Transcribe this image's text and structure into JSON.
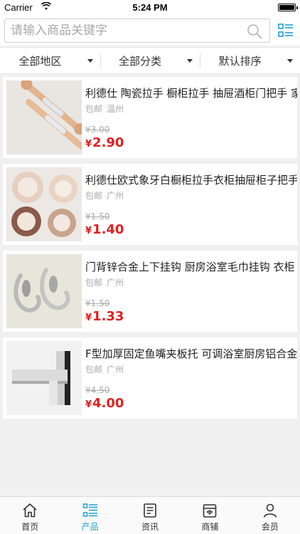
{
  "status_bar": {
    "carrier": "Carrier",
    "time": "5:24 PM"
  },
  "search": {
    "placeholder": "请输入商品关键字"
  },
  "filters": [
    {
      "label": "全部地区"
    },
    {
      "label": "全部分类"
    },
    {
      "label": "默认排序"
    }
  ],
  "products": [
    {
      "title": "利德仕 陶瓷拉手 橱柜拉手 抽屉酒柜门把手 家",
      "shipping": "包邮",
      "city": "温州",
      "old_price": "¥3.00",
      "currency": "¥",
      "price": "2.90"
    },
    {
      "title": "利德仕欧式象牙白橱柜拉手衣柜抽屉柜子把手",
      "shipping": "包邮",
      "city": "广州",
      "old_price": "¥1.50",
      "currency": "¥",
      "price": "1.40"
    },
    {
      "title": "门背锌合金上下挂钩 厨房浴室毛巾挂钩 衣柜",
      "shipping": "包邮",
      "city": "广州",
      "old_price": "¥1.50",
      "currency": "¥",
      "price": "1.33"
    },
    {
      "title": "F型加厚固定鱼嘴夹板托 可调浴室厨房铝合金",
      "shipping": "包邮",
      "city": "广州",
      "old_price": "¥4.50",
      "currency": "¥",
      "price": "4.00"
    }
  ],
  "tabs": [
    {
      "label": "首页",
      "icon": "home-icon"
    },
    {
      "label": "产品",
      "icon": "product-list-icon",
      "active": true
    },
    {
      "label": "资讯",
      "icon": "news-icon"
    },
    {
      "label": "商铺",
      "icon": "shop-icon"
    },
    {
      "label": "会员",
      "icon": "member-icon"
    }
  ],
  "colors": {
    "accent": "#1da1d6",
    "price": "#e02020"
  }
}
